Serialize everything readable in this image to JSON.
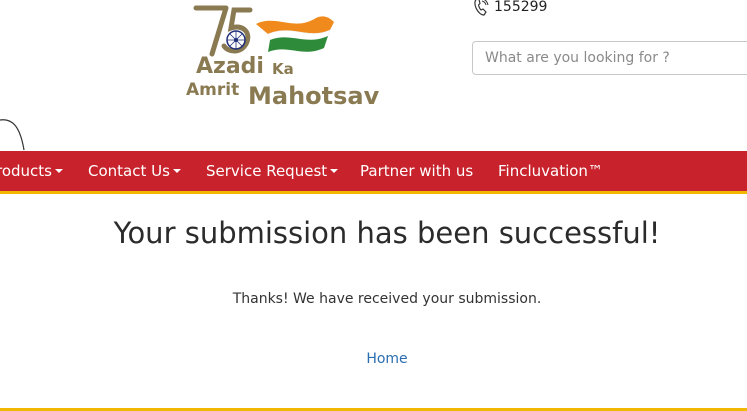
{
  "logo": {
    "line1": "Azadi",
    "line1_suffix": "Ka",
    "line2": "Amrit",
    "line2_suffix": "Mahotsav",
    "number": "75"
  },
  "contact": {
    "phone": "155299",
    "icon": "phone-icon"
  },
  "search": {
    "placeholder": "What are you looking for ?",
    "value": ""
  },
  "nav": {
    "items": [
      {
        "label": "roducts",
        "has_dropdown": true
      },
      {
        "label": "Contact Us",
        "has_dropdown": true
      },
      {
        "label": "Service Request",
        "has_dropdown": true
      },
      {
        "label": "Partner with us",
        "has_dropdown": false
      },
      {
        "label": "Fincluvation™",
        "has_dropdown": false
      }
    ]
  },
  "main": {
    "title": "Your submission has been successful!",
    "message": "Thanks! We have received your submission.",
    "home_link": "Home"
  },
  "colors": {
    "nav_background": "#c8232c",
    "accent_yellow": "#f2b700",
    "link_blue": "#2a6db0",
    "logo_gold": "#8a7a52",
    "flag_saffron": "#f08a1c",
    "flag_green": "#2e8b3a"
  }
}
